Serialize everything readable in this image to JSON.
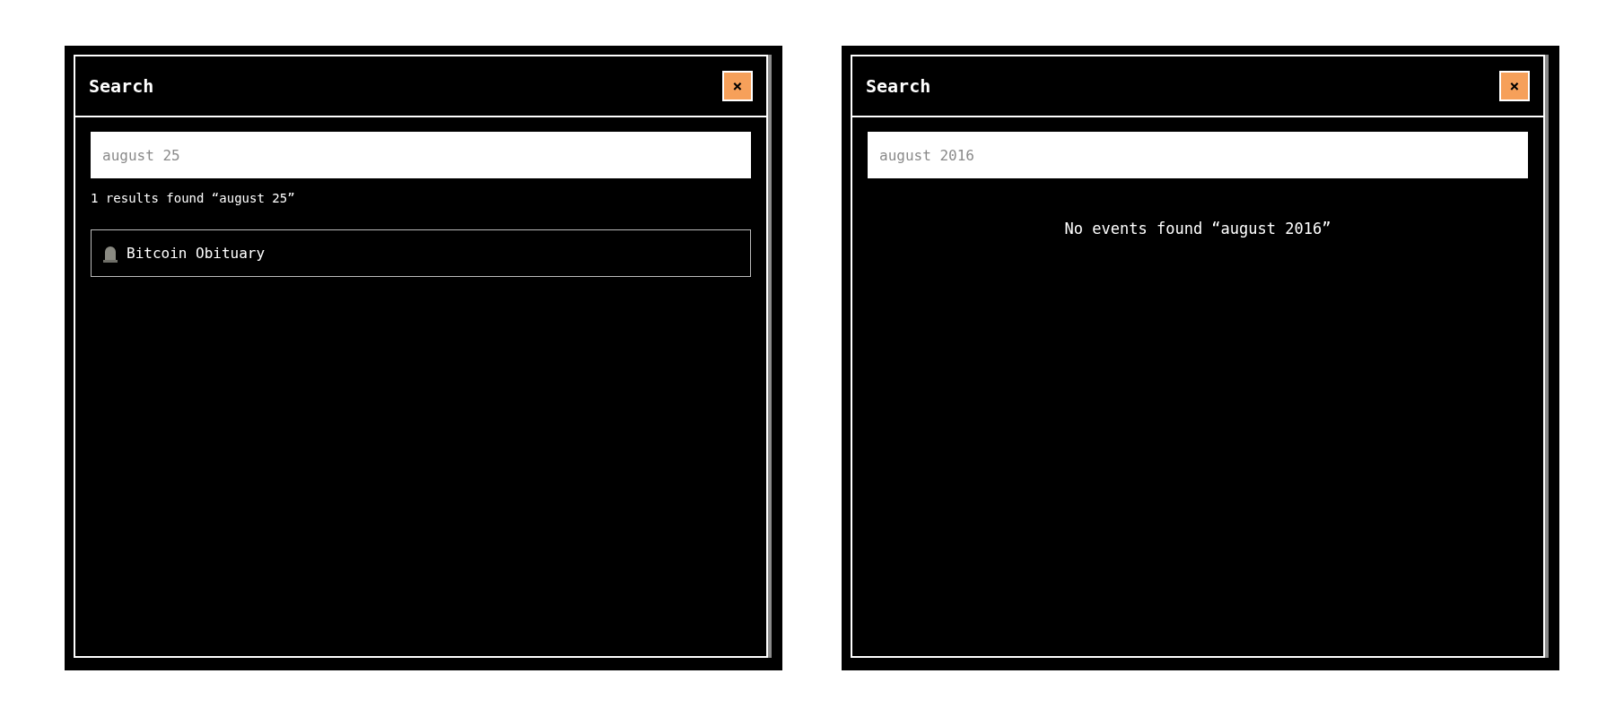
{
  "panels": [
    {
      "title": "Search",
      "close_label": "×",
      "search": {
        "value": "august 25"
      },
      "status": {
        "kind": "results",
        "text": "1 results found “august 25”"
      },
      "results": [
        {
          "label": "Bitcoin Obituary"
        }
      ]
    },
    {
      "title": "Search",
      "close_label": "×",
      "search": {
        "value": "august 2016"
      },
      "status": {
        "kind": "empty",
        "text": "No events found “august 2016”"
      }
    }
  ]
}
